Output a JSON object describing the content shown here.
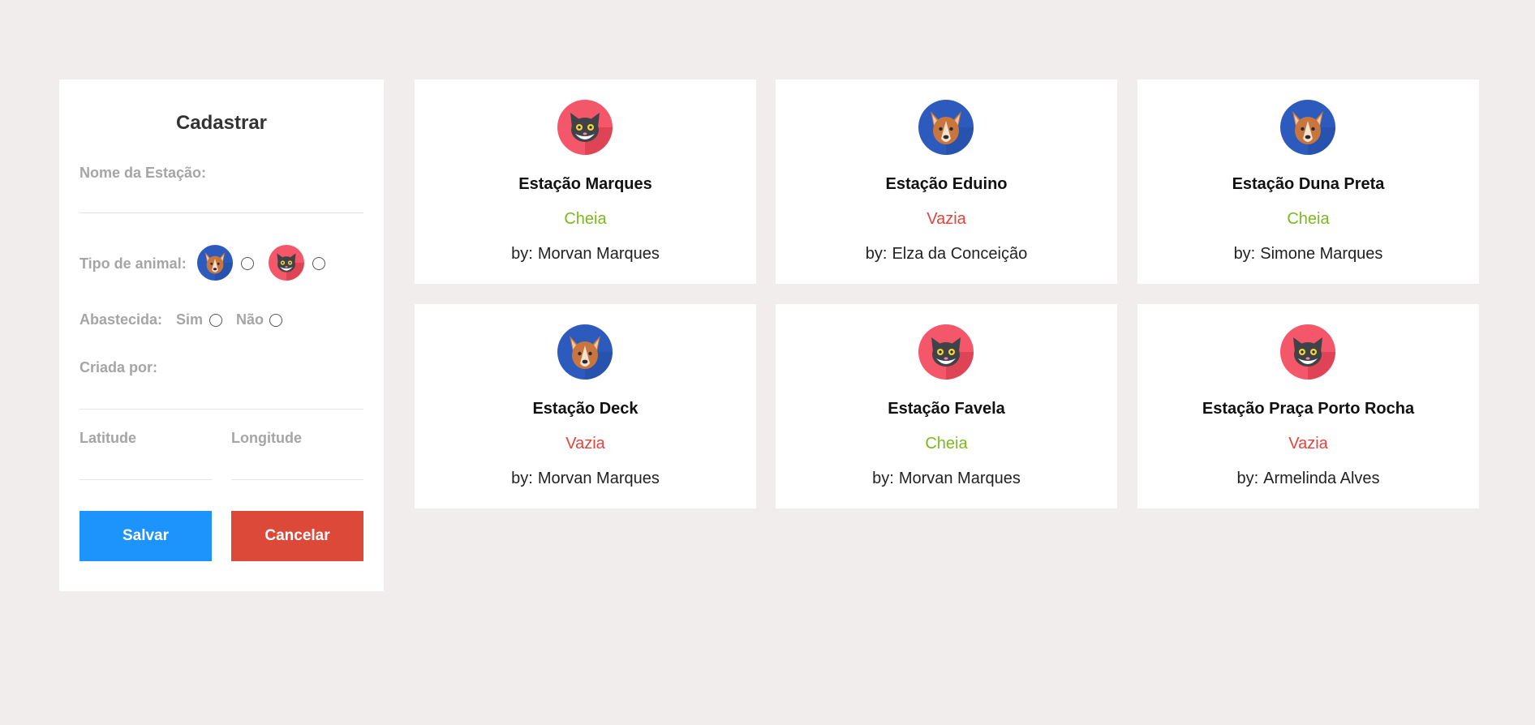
{
  "form": {
    "title": "Cadastrar",
    "name_label": "Nome da Estação:",
    "name_value": "",
    "animal_label": "Tipo de animal:",
    "animal_options": [
      "dog-icon",
      "cat-icon"
    ],
    "abastecida_label": "Abastecida:",
    "abastecida_yes": "Sim",
    "abastecida_no": "Não",
    "created_by_label": "Criada por:",
    "created_by_value": "",
    "latitude_label": "Latitude",
    "latitude_value": "",
    "longitude_label": "Longitude",
    "longitude_value": "",
    "save_label": "Salvar",
    "cancel_label": "Cancelar"
  },
  "stations": [
    {
      "animal": "cat-icon",
      "title": "Estação Marques",
      "status": "Cheia",
      "by": "by:",
      "author": "Morvan Marques"
    },
    {
      "animal": "dog-icon",
      "title": "Estação Eduino",
      "status": "Vazia",
      "by": "by:",
      "author": "Elza da Conceição"
    },
    {
      "animal": "dog-icon",
      "title": "Estação Duna Preta",
      "status": "Cheia",
      "by": "by:",
      "author": "Simone Marques"
    },
    {
      "animal": "dog-icon",
      "title": "Estação Deck",
      "status": "Vazia",
      "by": "by:",
      "author": "Morvan Marques"
    },
    {
      "animal": "cat-icon",
      "title": "Estação Favela",
      "status": "Cheia",
      "by": "by:",
      "author": "Morvan Marques"
    },
    {
      "animal": "cat-icon",
      "title": "Estação Praça Porto Rocha",
      "status": "Vazia",
      "by": "by:",
      "author": "Armelinda Alves"
    }
  ],
  "colors": {
    "background": "#f1eded",
    "save": "#1d93fc",
    "cancel": "#dc4939",
    "status_full": "#7cb91e",
    "status_empty": "#e0453c",
    "dog_circle": "#2d5bbd",
    "cat_circle": "#f4576a"
  }
}
